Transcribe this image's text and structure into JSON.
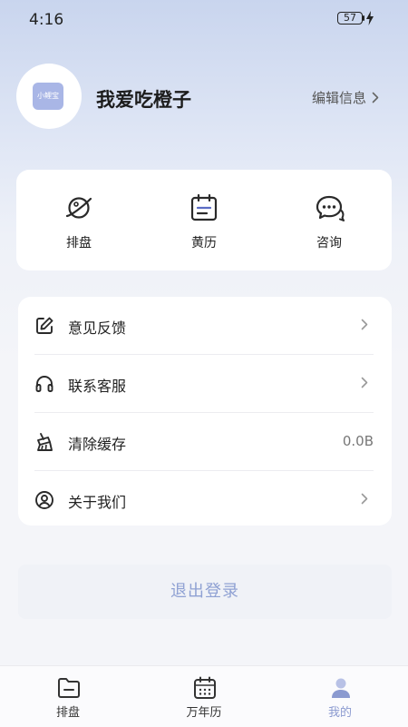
{
  "status_bar": {
    "time": "4:16",
    "battery": "57"
  },
  "profile": {
    "avatar_text": "小鲤宝",
    "user_name": "我爱吃橙子",
    "edit_label": "编辑信息"
  },
  "quick_actions": [
    {
      "label": "排盘",
      "icon": "planet-icon"
    },
    {
      "label": "黄历",
      "icon": "calendar-icon"
    },
    {
      "label": "咨询",
      "icon": "chat-bubbles-icon"
    }
  ],
  "menu": [
    {
      "label": "意见反馈",
      "icon": "edit-icon",
      "value": ""
    },
    {
      "label": "联系客服",
      "icon": "headset-icon",
      "value": ""
    },
    {
      "label": "清除缓存",
      "icon": "broom-icon",
      "value": "0.0B"
    },
    {
      "label": "关于我们",
      "icon": "user-circle-icon",
      "value": ""
    }
  ],
  "logout_label": "退出登录",
  "tabbar": [
    {
      "label": "排盘",
      "icon": "folder-icon"
    },
    {
      "label": "万年历",
      "icon": "calendar-grid-icon"
    },
    {
      "label": "我的",
      "icon": "person-icon",
      "active": true
    }
  ],
  "colors": {
    "accent": "#8b9ad0",
    "logout_text": "#8fa1d3",
    "avatar_bg": "#a9b6e6"
  }
}
